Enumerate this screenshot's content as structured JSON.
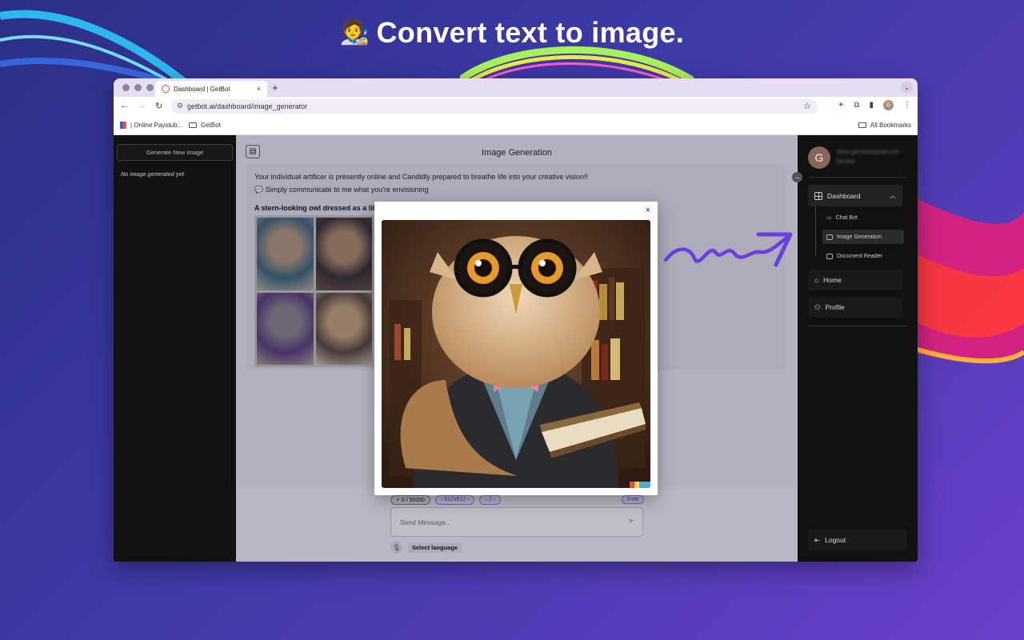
{
  "headline": {
    "emoji": "🧑‍🎨",
    "text": "Convert text to image."
  },
  "browser": {
    "tab_title": "Dashboard | GetBot",
    "tab_close": "×",
    "new_tab": "+",
    "url": "getbot.ai/dashboard/image_generator",
    "profile_initial": "G",
    "bookmarks": [
      {
        "label": "| Online Paystub...",
        "icon": "paystub-favicon"
      },
      {
        "label": "GetBot",
        "icon": "folder-icon"
      }
    ],
    "all_bookmarks": "All Bookmarks"
  },
  "left_panel": {
    "generate_button": "Generate New Image",
    "empty_state": "No image generated yet"
  },
  "center": {
    "title": "Image Generation",
    "message_1": "Your individual artificer is presently online and Candidly prepared to breathe life into your creative vision!!",
    "message_2": "💬 Simply communicate to me what you're envisioning",
    "prompt": "A stern-looking owl dressed as a lib"
  },
  "composer": {
    "credits": "⚡ 0 / 50000",
    "size": "512x512",
    "count": "2",
    "plan": "Free",
    "placeholder": "Send Message..",
    "language": "Select language"
  },
  "right_panel": {
    "user_initial": "G",
    "user_email": "rekus.get.bot@gmail.com",
    "user_name": "Get Bot",
    "dashboard": "Dashboard",
    "sub_items": [
      "Chat Bot",
      "Image Generation",
      "Document Reader"
    ],
    "home": "Home",
    "profile": "Profile",
    "logout": "Logout"
  },
  "modal": {
    "close": "×"
  },
  "colors": {
    "background_start": "#2c2f86",
    "background_end": "#6a3fc9",
    "accent_purple": "#5b3fc0",
    "arrow": "#6a3fe0",
    "sidebar": "#111111"
  }
}
